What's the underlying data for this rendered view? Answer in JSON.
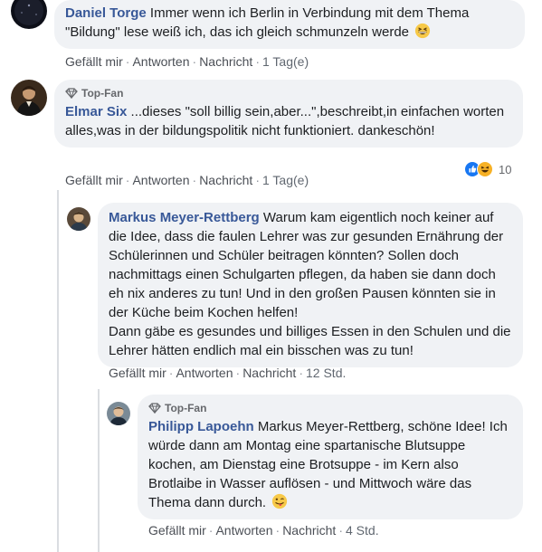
{
  "comments": [
    {
      "author": "Daniel Torge",
      "text": "Immer wenn ich Berlin in Verbindung mit dem Thema \"Bildung\" lese weiß ich, das ich gleich schmunzeln werde",
      "emoji": "grinning-squinting-face",
      "badge": "",
      "actions": {
        "like": "Gefällt mir",
        "reply": "Antworten",
        "message": "Nachricht",
        "time": "1 Tag(e)"
      }
    },
    {
      "author": "Elmar Six",
      "text": "...dieses \"soll billig sein,aber...\",beschreibt,in einfachen worten alles,was in der bildungspolitik nicht funktioniert. dankeschön!",
      "badge": "Top-Fan",
      "actions": {
        "like": "Gefällt mir",
        "reply": "Antworten",
        "message": "Nachricht",
        "time": "1 Tag(e)"
      },
      "reactions": {
        "icons": [
          "like-icon",
          "haha-icon"
        ],
        "count": "10"
      }
    },
    {
      "author": "Markus Meyer-Rettberg",
      "text": "Warum kam eigentlich noch keiner auf die Idee, dass die faulen Lehrer was zur gesunden Ernährung der Schülerinnen und Schüler beitragen könnten? Sollen doch nachmittags einen Schulgarten pflegen, da haben sie dann doch eh nix anderes zu tun! Und in den großen Pausen könnten sie in der Küche beim Kochen helfen!",
      "text2": "Dann gäbe es gesundes und billiges Essen in den Schulen und die Lehrer hätten endlich mal ein bisschen was zu tun!",
      "badge": "",
      "actions": {
        "like": "Gefällt mir",
        "reply": "Antworten",
        "message": "Nachricht",
        "time": "12 Std."
      }
    },
    {
      "author": "Philipp Lapoehn",
      "text": "Markus Meyer-Rettberg, schöne Idee! Ich würde dann am Montag eine spartanische Blutsuppe kochen, am Dienstag eine Brotsuppe - im Kern also Brotlaibe in Wasser auflösen - und Mittwoch wäre das Thema dann durch.",
      "emoji": "winking-face-with-tongue",
      "badge": "Top-Fan",
      "actions": {
        "like": "Gefällt mir",
        "reply": "Antworten",
        "message": "Nachricht",
        "time": "4 Std."
      }
    }
  ],
  "colors": {
    "author": "#385898",
    "bubble": "#f0f2f5",
    "action": "#4b4f56",
    "badge": "#65676b"
  }
}
